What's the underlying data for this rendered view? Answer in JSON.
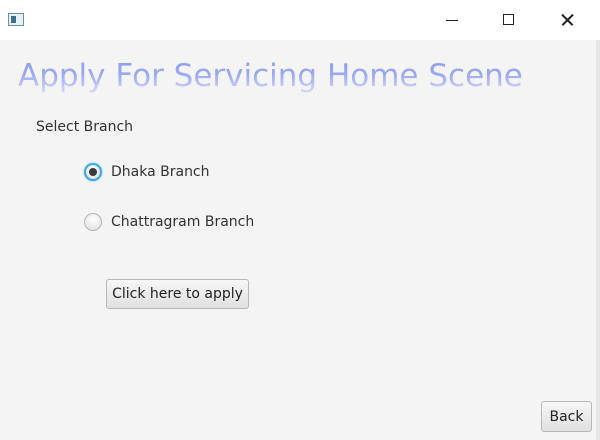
{
  "window": {
    "app_icon": "java-window-icon",
    "controls": [
      "minimize-icon",
      "maximize-icon",
      "close-icon"
    ]
  },
  "scene": {
    "title": "Apply For Servicing Home Scene",
    "select_label": "Select Branch",
    "branches": [
      {
        "label": "Dhaka Branch",
        "selected": true
      },
      {
        "label": "Chattragram Branch",
        "selected": false
      }
    ],
    "apply_label": "Click here to apply",
    "back_label": "Back"
  },
  "colors": {
    "title_gradient_top": "#8a9bf0",
    "radio_focus": "#3fa7dd",
    "background": "#f4f4f4"
  }
}
